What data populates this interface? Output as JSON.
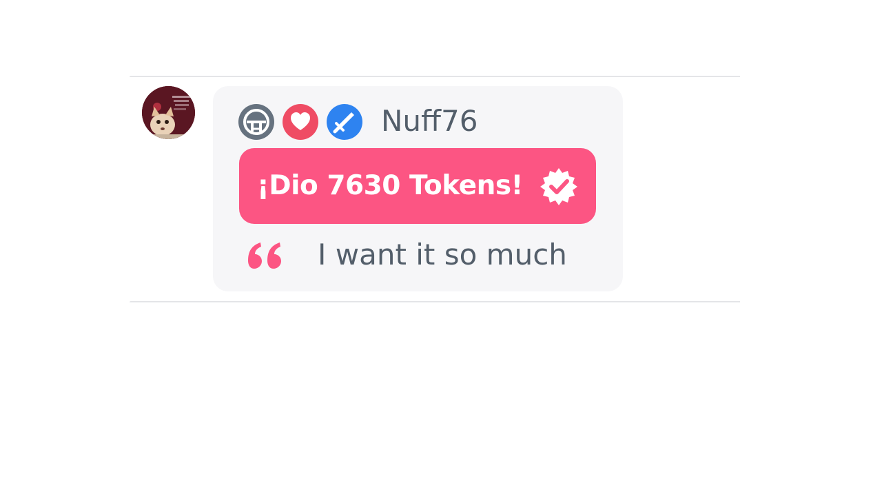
{
  "comment": {
    "avatar": {
      "icon": "user-avatar-cat"
    },
    "badges": [
      {
        "icon": "helmet-icon",
        "color": "#66727f"
      },
      {
        "icon": "heart-icon",
        "color": "#ef4c64"
      },
      {
        "icon": "sword-icon",
        "color": "#2e83f0"
      }
    ],
    "username": "Nuff76",
    "tokens_banner": {
      "text": "¡Dio 7630 Tokens!",
      "icon": "verified-seal-icon",
      "color": "#fc5583"
    },
    "quote_icon": "quote-icon",
    "message": "I want it so much"
  },
  "colors": {
    "accent": "#fc5583",
    "text": "#535e6a",
    "card_background": "#f6f6f8"
  }
}
